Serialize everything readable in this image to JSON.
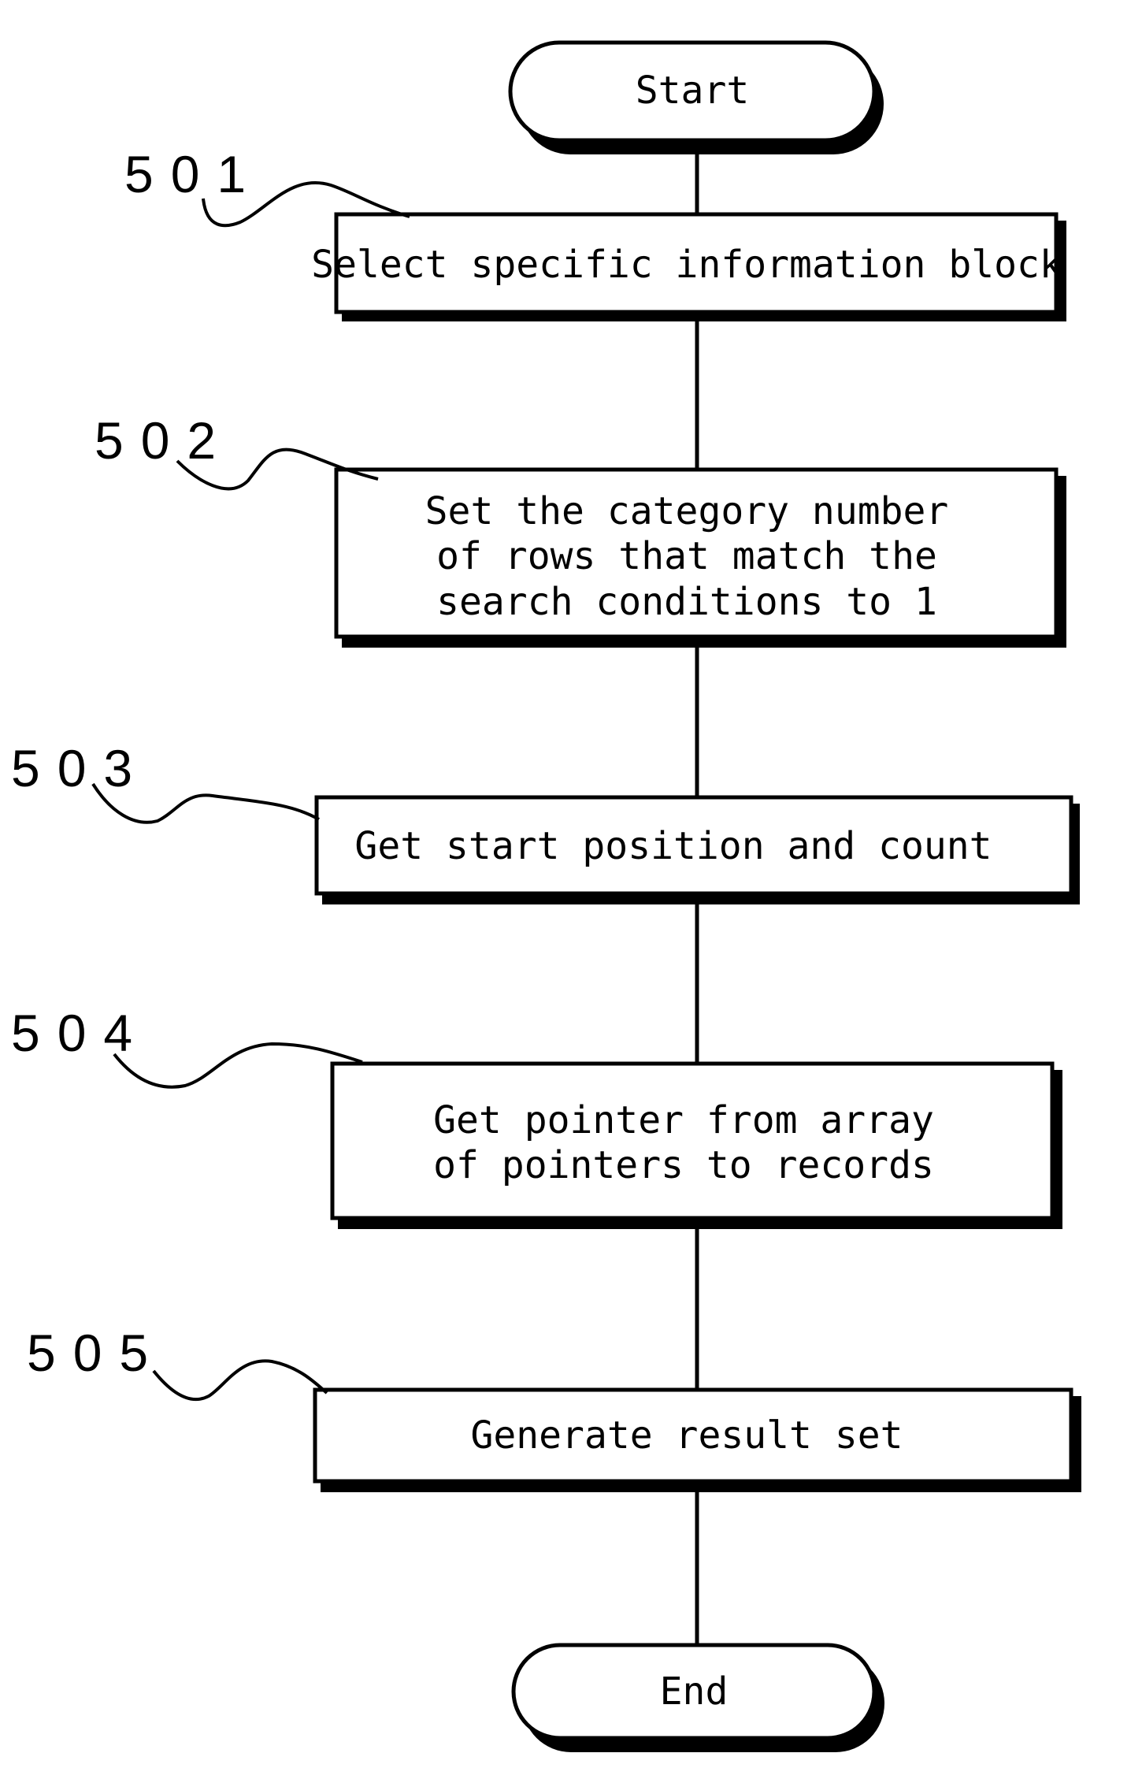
{
  "diagram": {
    "type": "flowchart",
    "start": {
      "label": "Start"
    },
    "end": {
      "label": "End"
    },
    "steps": [
      {
        "ref": "501",
        "lines": [
          "Select specific information block"
        ]
      },
      {
        "ref": "502",
        "lines": [
          "Set the category number",
          "of rows that match the",
          "search conditions to 1"
        ]
      },
      {
        "ref": "503",
        "lines": [
          "Get start position and count"
        ]
      },
      {
        "ref": "504",
        "lines": [
          "Get pointer from array",
          "of pointers to records"
        ]
      },
      {
        "ref": "505",
        "lines": [
          "Generate result set"
        ]
      }
    ],
    "flow": [
      "Start",
      "501",
      "502",
      "503",
      "504",
      "505",
      "End"
    ]
  }
}
